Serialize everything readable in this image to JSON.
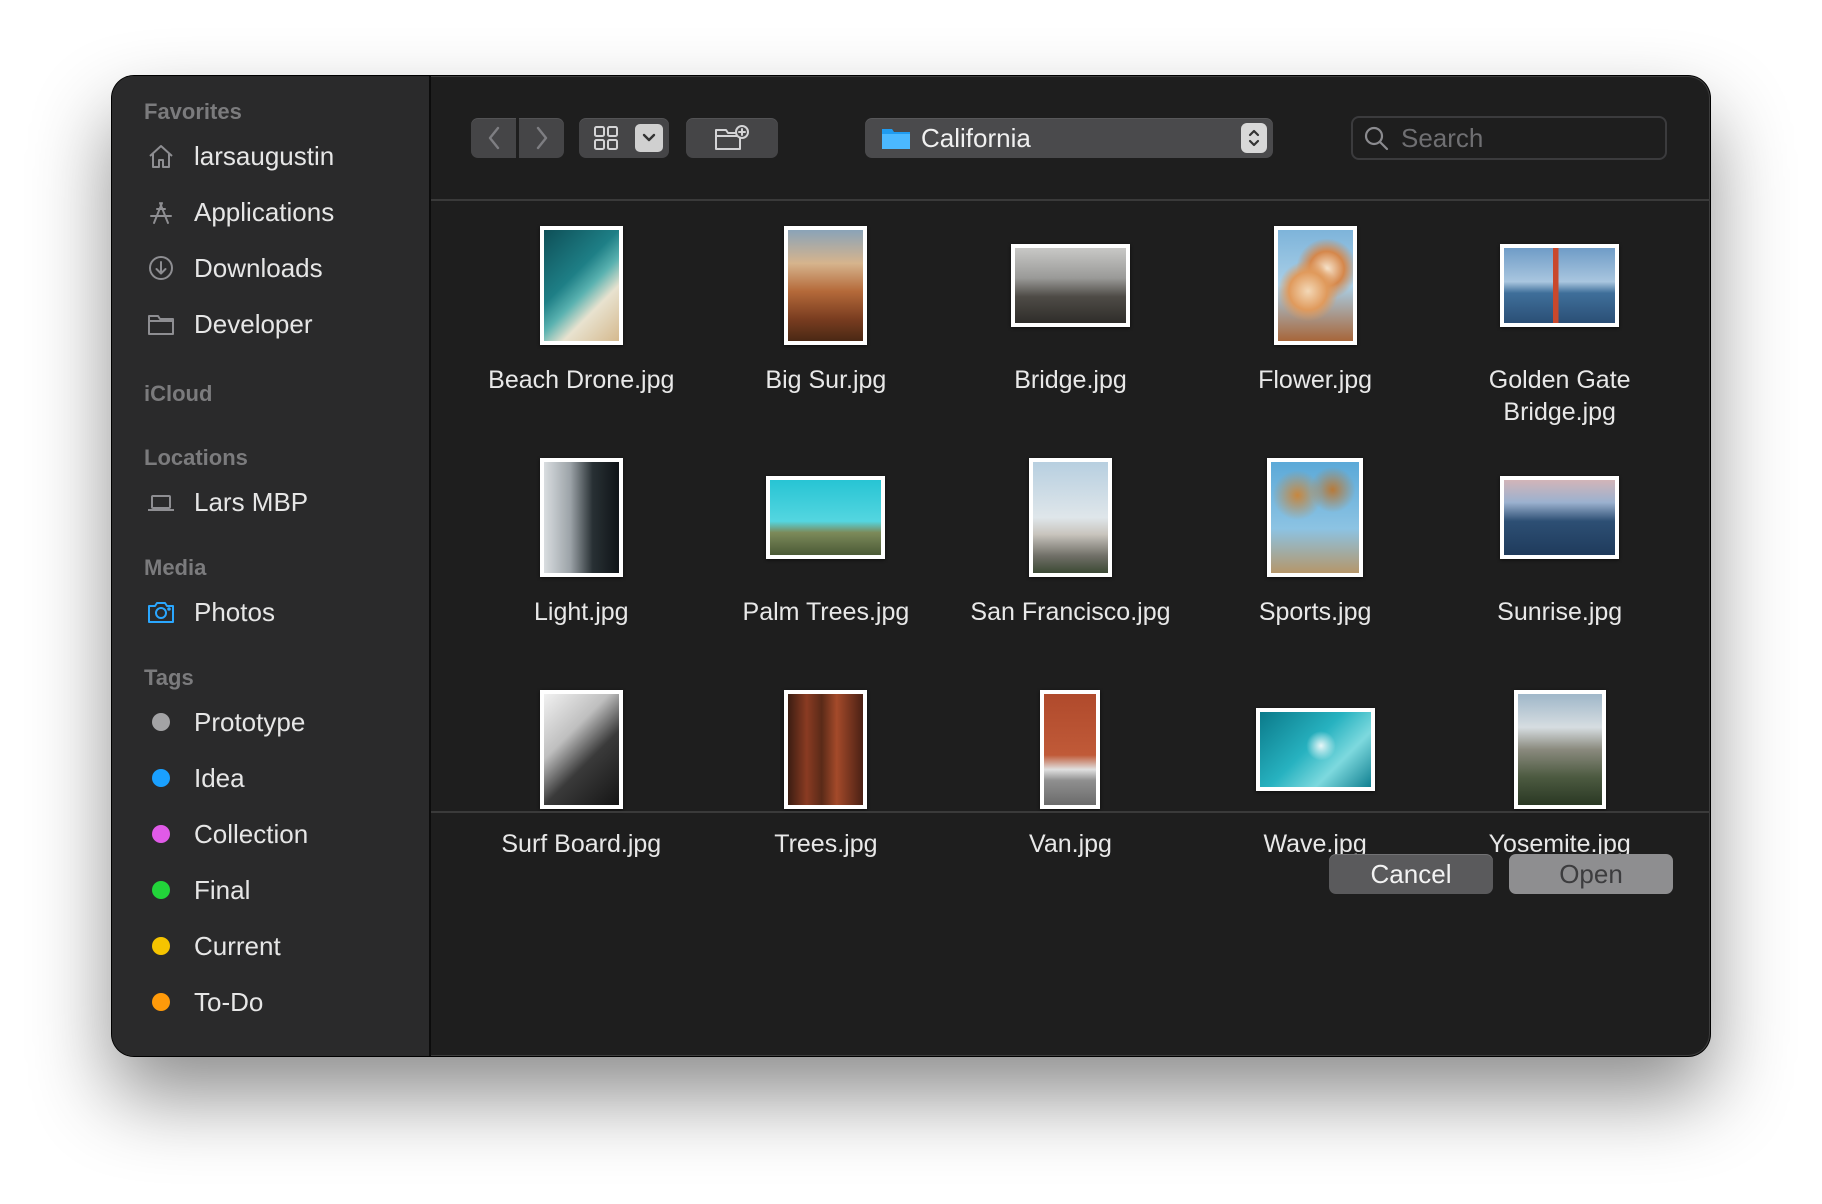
{
  "sidebar": {
    "sections": {
      "favorites": "Favorites",
      "icloud": "iCloud",
      "locations": "Locations",
      "media": "Media",
      "tags": "Tags"
    },
    "favorites": [
      {
        "label": "larsaugustin",
        "icon": "home-icon"
      },
      {
        "label": "Applications",
        "icon": "applications-icon"
      },
      {
        "label": "Downloads",
        "icon": "downloads-icon"
      },
      {
        "label": "Developer",
        "icon": "folder-icon"
      }
    ],
    "locations": [
      {
        "label": "Lars MBP",
        "icon": "laptop-icon"
      }
    ],
    "media": [
      {
        "label": "Photos",
        "icon": "camera-icon"
      }
    ],
    "tags": [
      {
        "label": "Prototype",
        "color": "#a3a3a5"
      },
      {
        "label": "Idea",
        "color": "#1aa0ff"
      },
      {
        "label": "Collection",
        "color": "#e05ae8"
      },
      {
        "label": "Final",
        "color": "#22d43a"
      },
      {
        "label": "Current",
        "color": "#f5c400"
      },
      {
        "label": "To-Do",
        "color": "#ff9a0a"
      }
    ]
  },
  "toolbar": {
    "current_folder": "California",
    "search_placeholder": "Search"
  },
  "files": [
    {
      "name": "Beach Drone.jpg",
      "orientation": "portrait"
    },
    {
      "name": "Big Sur.jpg",
      "orientation": "portrait"
    },
    {
      "name": "Bridge.jpg",
      "orientation": "landscape"
    },
    {
      "name": "Flower.jpg",
      "orientation": "portrait"
    },
    {
      "name": "Golden Gate Bridge.jpg",
      "orientation": "landscape"
    },
    {
      "name": "Light.jpg",
      "orientation": "portrait"
    },
    {
      "name": "Palm Trees.jpg",
      "orientation": "landscape"
    },
    {
      "name": "San Francisco.jpg",
      "orientation": "portrait"
    },
    {
      "name": "Sports.jpg",
      "orientation": "square"
    },
    {
      "name": "Sunrise.jpg",
      "orientation": "landscape"
    },
    {
      "name": "Surf Board.jpg",
      "orientation": "portrait"
    },
    {
      "name": "Trees.jpg",
      "orientation": "portrait"
    },
    {
      "name": "Van.jpg",
      "orientation": "portrait"
    },
    {
      "name": "Wave.jpg",
      "orientation": "landscape"
    },
    {
      "name": "Yosemite.jpg",
      "orientation": "portrait"
    }
  ],
  "footer": {
    "cancel_label": "Cancel",
    "open_label": "Open"
  }
}
